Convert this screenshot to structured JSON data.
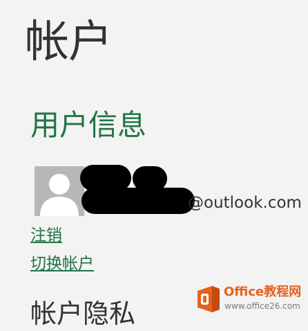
{
  "page": {
    "title": "帐户"
  },
  "user_info": {
    "heading": "用户信息",
    "email_suffix": "@outlook.com",
    "sign_out_label": "注销",
    "switch_account_label": "切换帐户"
  },
  "privacy": {
    "heading": "帐户隐私"
  },
  "watermark": {
    "name": "Office教程网",
    "url": "www.office26.com"
  },
  "colors": {
    "background": "#f3f3f3",
    "accent": "#217346",
    "text": "#333333",
    "avatar_bg": "#b7b7b7",
    "watermark_orange": "#e8601c"
  },
  "icons": {
    "avatar": "user-silhouette-icon",
    "watermark_logo": "office-logo-icon"
  }
}
